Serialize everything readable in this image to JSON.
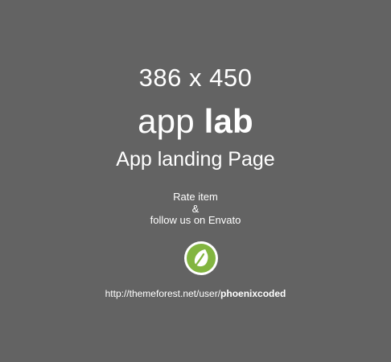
{
  "placeholder": {
    "dimensions": "386 x 450",
    "brand": {
      "light": "app ",
      "bold": "lab"
    },
    "subtitle": "App landing Page",
    "rate": {
      "line1": "Rate item",
      "line2": "&",
      "line3": "follow us on Envato"
    },
    "icon": "envato-leaf-icon",
    "link": {
      "prefix": "http://themeforest.net/user/",
      "username": "phoenixcoded"
    }
  },
  "colors": {
    "background": "#636363",
    "text": "#ffffff",
    "envato_green": "#82b540"
  }
}
